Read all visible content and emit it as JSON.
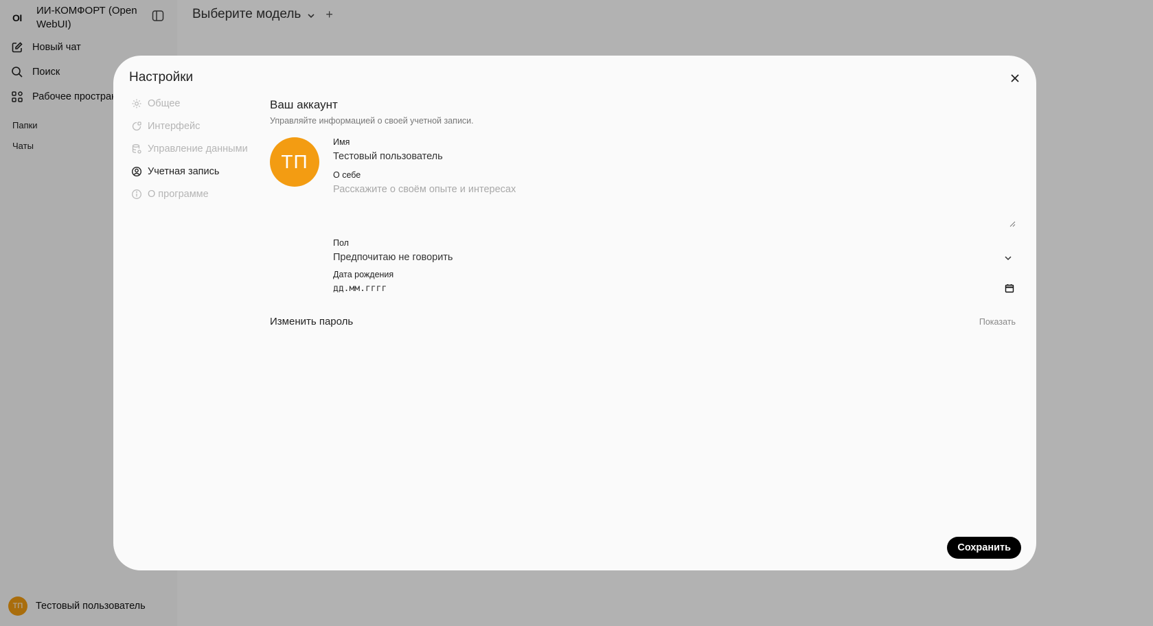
{
  "sidebar": {
    "logo": "OI",
    "app_name": "ИИ-КОМФОРТ (Open WebUI)",
    "items": [
      {
        "label": "Новый чат",
        "icon": "edit-icon"
      },
      {
        "label": "Поиск",
        "icon": "search-icon"
      },
      {
        "label": "Рабочее пространство",
        "icon": "grid-icon"
      }
    ],
    "folders_label": "Папки",
    "chats_label": "Чаты",
    "user": {
      "initials": "ТП",
      "name": "Тестовый пользователь"
    }
  },
  "topbar": {
    "model_label": "Выберите модель",
    "plus": "+"
  },
  "modal": {
    "title": "Настройки",
    "tabs": [
      {
        "label": "Общее",
        "icon": "gear-icon",
        "active": false
      },
      {
        "label": "Интерфейс",
        "icon": "interface-icon",
        "active": false
      },
      {
        "label": "Управление данными",
        "icon": "database-icon",
        "active": false
      },
      {
        "label": "Учетная запись",
        "icon": "user-circle-icon",
        "active": true
      },
      {
        "label": "О программе",
        "icon": "info-icon",
        "active": false
      }
    ],
    "account": {
      "heading": "Ваш аккаунт",
      "subheading": "Управляйте информацией о своей учетной записи.",
      "avatar_initials": "ТП",
      "name_label": "Имя",
      "name_value": "Тестовый пользователь",
      "bio_label": "О себе",
      "bio_placeholder": "Расскажите о своём опыте и интересах",
      "gender_label": "Пол",
      "gender_value": "Предпочитаю не говорить",
      "birth_label": "Дата рождения",
      "birth_placeholder": "дд.мм.гггг",
      "password_label": "Изменить пароль",
      "show_label": "Показать"
    },
    "save_label": "Сохранить"
  },
  "colors": {
    "accent_avatar": "#f39c12",
    "save_button": "#000000"
  }
}
